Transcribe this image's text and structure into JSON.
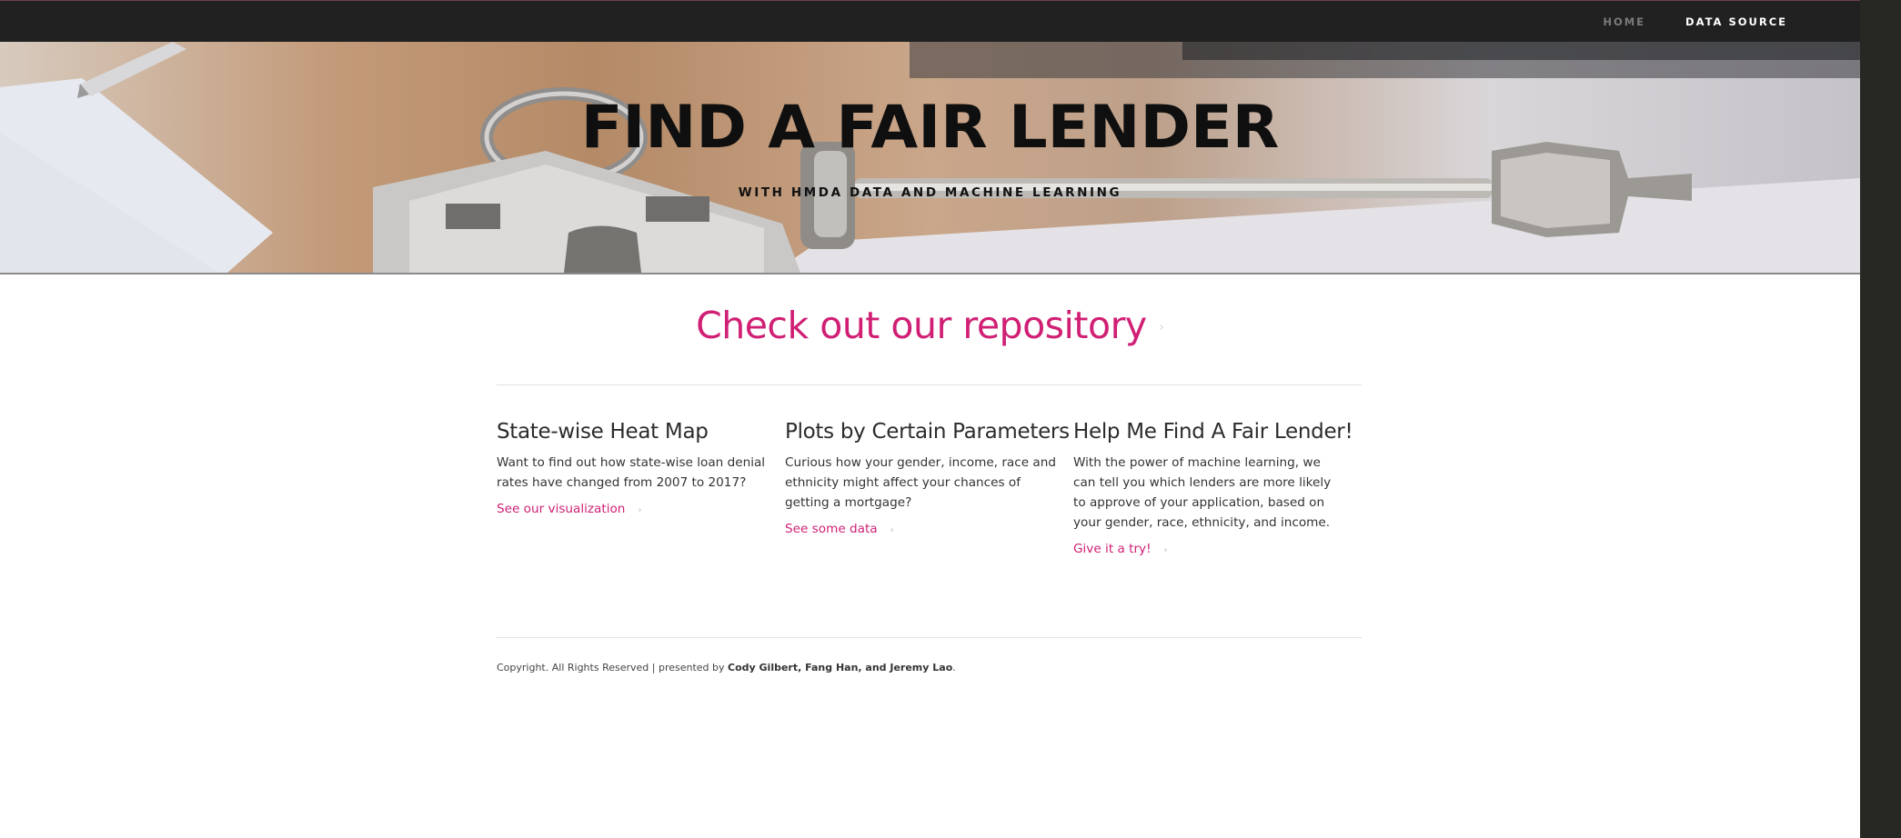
{
  "nav": {
    "home": "HOME",
    "data_source": "DATA SOURCE"
  },
  "hero": {
    "title": "FIND A FAIR LENDER",
    "subtitle": "WITH HMDA DATA AND MACHINE LEARNING"
  },
  "repo": {
    "label": "Check out our repository",
    "chevron": "›"
  },
  "features": [
    {
      "title": "State-wise Heat Map",
      "text": "Want to find out how state-wise loan denial rates have changed from 2007 to 2017?",
      "link": "See our visualization"
    },
    {
      "title": "Plots by Certain Parameters",
      "text": "Curious how your gender, income, race and ethnicity might affect your chances of getting a mortgage?",
      "link": "See some data"
    },
    {
      "title": "Help Me Find A Fair Lender!",
      "text": "With the power of machine learning, we can tell you which lenders are more likely to approve of your application, based on your gender, race, ethnicity, and income.",
      "link": "Give it a try!"
    }
  ],
  "footer": {
    "prefix": "Copyright. All Rights Reserved | presented by ",
    "authors": "Cody Gilbert, Fang Han, and Jeremy Lao",
    "suffix": "."
  },
  "colors": {
    "accent": "#d01f74",
    "navbar": "#212121",
    "frame": "#272823"
  }
}
